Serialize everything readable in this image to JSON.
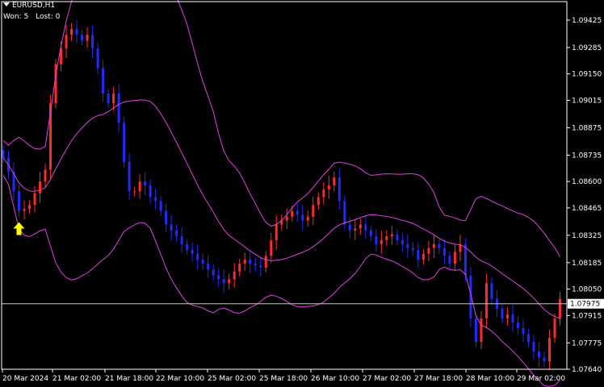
{
  "header": {
    "symbol": "EURUSD,H1",
    "won_label": "Won:",
    "won_value": "5",
    "lost_label": "Lost:",
    "lost_value": "0",
    "menu_icon": "triangle-down-icon"
  },
  "colors": {
    "background": "#000000",
    "bull_candle": "#ff2a2a",
    "bear_candle": "#1e2bff",
    "bands": "#e040e0",
    "arrow": "#ffff00",
    "price_line": "#c8c8c8",
    "axis": "#ffffff"
  },
  "chart_data": {
    "type": "candlestick",
    "title": "EURUSD,H1",
    "xlabel": "",
    "ylabel": "",
    "ylim": [
      1.0758,
      1.0955
    ],
    "y_ticks": [
      "1.09425",
      "1.09285",
      "1.09150",
      "1.09015",
      "1.08875",
      "1.08735",
      "1.08600",
      "1.08465",
      "1.08325",
      "1.08185",
      "1.08050",
      "1.07915",
      "1.07775",
      "1.07640"
    ],
    "y_tick_values": [
      1.09425,
      1.09285,
      1.0915,
      1.09015,
      1.08875,
      1.08735,
      1.086,
      1.08465,
      1.08325,
      1.08185,
      1.0805,
      1.07915,
      1.07775,
      1.0764
    ],
    "x_ticks": [
      "20 Mar 2024",
      "21 Mar 02:00",
      "21 Mar 18:00",
      "22 Mar 10:00",
      "25 Mar 02:00",
      "25 Mar 18:00",
      "26 Mar 10:00",
      "27 Mar 02:00",
      "27 Mar 18:00",
      "28 Mar 10:00",
      "29 Mar 02:00"
    ],
    "current_price": 1.07975,
    "current_price_label": "1.07975",
    "closes": [
      1.0872,
      1.0865,
      1.0855,
      1.0845,
      1.0846,
      1.0848,
      1.0854,
      1.086,
      1.0866,
      1.09,
      1.092,
      1.0928,
      1.0935,
      1.0938,
      1.0935,
      1.0932,
      1.0935,
      1.0928,
      1.0918,
      1.0905,
      1.09,
      1.0905,
      1.089,
      1.087,
      1.0855,
      1.0855,
      1.086,
      1.0858,
      1.0852,
      1.085,
      1.0845,
      1.0838,
      1.0835,
      1.0832,
      1.0828,
      1.0825,
      1.0823,
      1.082,
      1.0818,
      1.0815,
      1.0812,
      1.081,
      1.0808,
      1.081,
      1.0814,
      1.0818,
      1.082,
      1.0818,
      1.0817,
      1.0816,
      1.0822,
      1.083,
      1.0838,
      1.084,
      1.0842,
      1.0845,
      1.0843,
      1.084,
      1.0842,
      1.0848,
      1.0852,
      1.0856,
      1.0858,
      1.0862,
      1.085,
      1.0838,
      1.0835,
      1.0836,
      1.0838,
      1.0835,
      1.0832,
      1.0828,
      1.083,
      1.0832,
      1.0833,
      1.083,
      1.0828,
      1.0826,
      1.0825,
      1.082,
      1.0823,
      1.0826,
      1.0828,
      1.0826,
      1.0822,
      1.0818,
      1.0824,
      1.0828,
      1.0812,
      1.079,
      1.0778,
      1.079,
      1.0808,
      1.08,
      1.0795,
      1.079,
      1.0792,
      1.0788,
      1.0785,
      1.0782,
      1.0778,
      1.0773,
      1.077,
      1.0768,
      1.078,
      1.079,
      1.08
    ]
  }
}
